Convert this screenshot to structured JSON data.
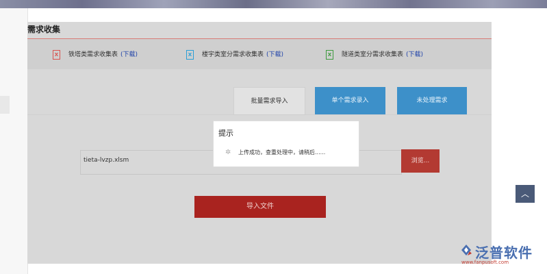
{
  "page": {
    "title": "需求收集"
  },
  "downloads": [
    {
      "label": "铁塔类需求收集表",
      "link": "(下载)",
      "color": "#d9534f"
    },
    {
      "label": "楼宇类室分需求收集表",
      "link": "(下载)",
      "color": "#2a9fd6"
    },
    {
      "label": "隧道类室分需求收集表",
      "link": "(下载)",
      "color": "#3c9a3c"
    }
  ],
  "tabs": [
    {
      "label": "批量需求导入",
      "active": true
    },
    {
      "label": "单个需求录入",
      "active": false
    },
    {
      "label": "未处理需求",
      "active": false
    }
  ],
  "upload": {
    "file_name": "tieta-lvzp.xlsm",
    "browse_label": "浏览...",
    "import_label": "导入文件"
  },
  "modal": {
    "title": "提示",
    "message": "上传成功，查重处理中，请稍后......"
  },
  "logo": {
    "name": "泛普软件",
    "url": "www.fanpusoft.com"
  }
}
